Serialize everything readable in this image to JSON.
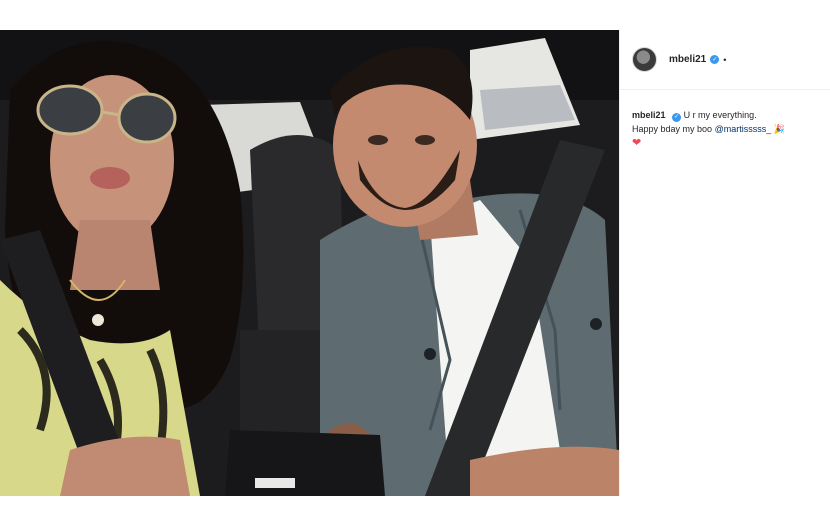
{
  "post": {
    "username": "mbeli21",
    "header_more": "•",
    "caption": {
      "username": "mbeli21",
      "line1": "U r my everything.",
      "line2_prefix": "Happy bday my boo",
      "mention": "@martisssss_",
      "emoji_party": "🎉",
      "emoji_heart": "❤"
    },
    "verified_glyph": "✓"
  },
  "colors": {
    "verified": "#3897f0",
    "heart": "#ed4956",
    "mention": "#003569"
  }
}
